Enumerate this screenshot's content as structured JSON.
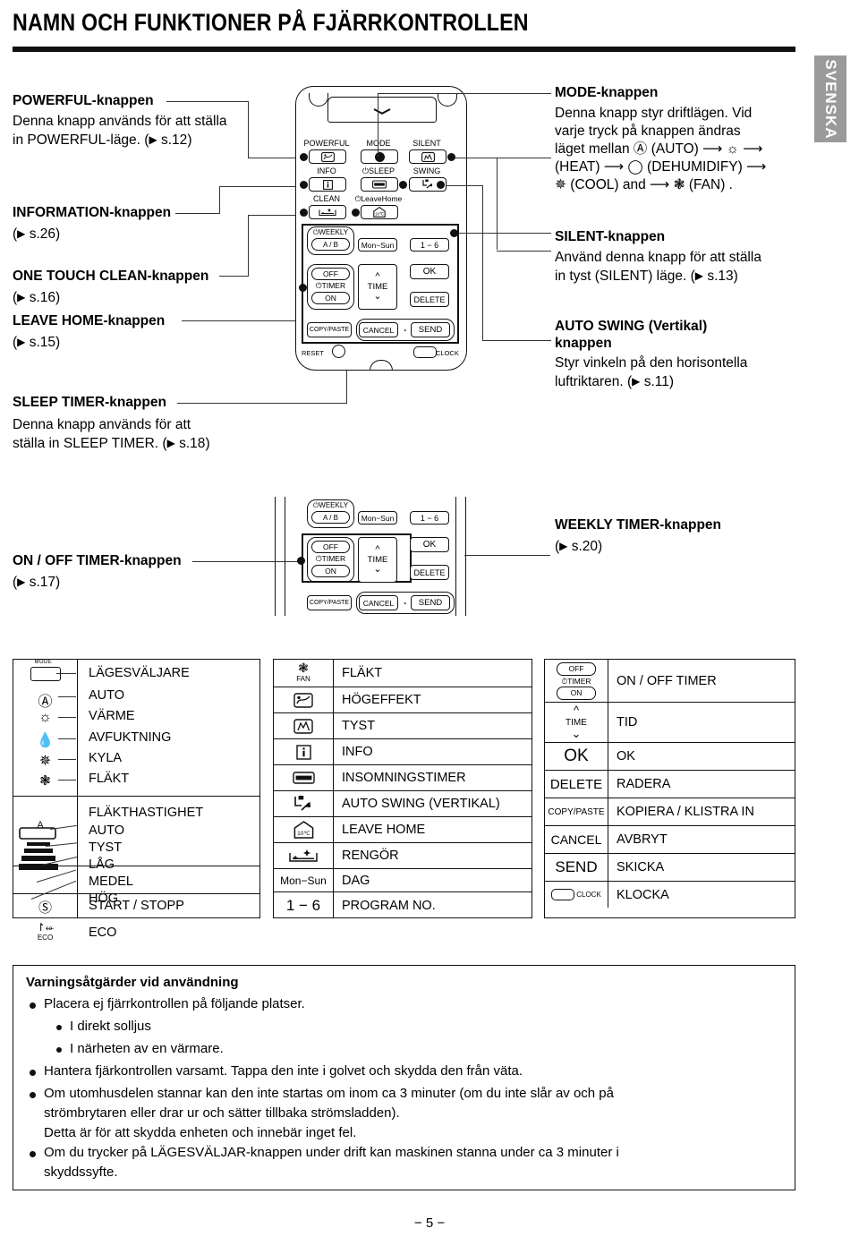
{
  "header": {
    "title": "NAMN OCH FUNKTIONER PÅ FJÄRRKONTROLLEN",
    "language_tab": "SVENSKA"
  },
  "callouts_left": [
    {
      "id": "powerful",
      "heading": "POWERFUL-knappen",
      "body_line1": "Denna knapp används för att ställa",
      "body_line2": "in POWERFUL-läge. (",
      "ref": "s.12",
      "body_line2_end": ")"
    },
    {
      "id": "information",
      "heading": "INFORMATION-knappen",
      "ref_line": "(",
      "ref": "s.26",
      "ref_end": ")"
    },
    {
      "id": "one-touch-clean",
      "heading": "ONE TOUCH CLEAN-knappen",
      "ref_line": "(",
      "ref": "s.16",
      "ref_end": ")"
    },
    {
      "id": "leave-home",
      "heading": "LEAVE HOME-knappen",
      "ref_line": "(",
      "ref": "s.15",
      "ref_end": ")"
    },
    {
      "id": "sleep-timer",
      "heading": "SLEEP TIMER-knappen",
      "body_line1": "Denna knapp används för att",
      "body_line2": "ställa in SLEEP TIMER. (",
      "ref": "s.18",
      "body_line2_end": ")"
    },
    {
      "id": "on-off-timer",
      "heading": "ON / OFF TIMER-knappen",
      "ref_line": "(",
      "ref": "s.17",
      "ref_end": ")"
    }
  ],
  "callouts_right": [
    {
      "id": "mode",
      "heading": "MODE-knappen",
      "l1": "Denna knapp styr driftlägen. Vid",
      "l2": "varje tryck på knappen ändras",
      "l3a": "läget mellan ",
      "l3b": " (AUTO) ",
      "l3c": " ",
      "l4a": "(HEAT) ",
      "l4b": " (DEHUMIDIFY) ",
      "l5a": " (COOL)  and ",
      "l5b": " (FAN) ."
    },
    {
      "id": "silent",
      "heading": "SILENT-knappen",
      "l1": "Använd denna knapp för att ställa",
      "l2a": "in tyst (SILENT) läge. (",
      "ref": "s.13",
      "l2b": ")"
    },
    {
      "id": "auto-swing",
      "heading_l1": "AUTO SWING (Vertikal)",
      "heading_l2": "knappen",
      "l1": "Styr vinkeln på den horisontella",
      "l2a": "luftriktaren. (",
      "ref": "s.11",
      "l2b": ")"
    },
    {
      "id": "weekly-timer",
      "heading": "WEEKLY TIMER-knappen",
      "ref_line": "(",
      "ref": "s.20",
      "ref_end": ")"
    }
  ],
  "remote": {
    "buttons": {
      "powerful": "POWERFUL",
      "mode": "MODE",
      "silent": "SILENT",
      "info": "INFO",
      "sleep": "SLEEP",
      "swing": "SWING",
      "clean": "CLEAN",
      "leave_home": "LeaveHome",
      "weekly": "WEEKLY",
      "ab": "A / B",
      "mon_sun": "Mon−Sun",
      "one_six": "1 − 6",
      "off": "OFF",
      "timer": "TIMER",
      "on": "ON",
      "time": "TIME",
      "ok": "OK",
      "delete": "DELETE",
      "copy_paste": "COPY/PASTE",
      "cancel": "CANCEL",
      "send": "SEND",
      "reset": "RESET",
      "clock": "CLOCK"
    }
  },
  "symbol_table": {
    "left_column": {
      "section1": [
        {
          "icon": "mode-button-icon",
          "label": "LÄGESVÄLJARE"
        },
        {
          "icon": "auto-a-icon",
          "label": "AUTO"
        },
        {
          "icon": "sun-heat-icon",
          "label": "VÄRME"
        },
        {
          "icon": "droplet-dehumidify-icon",
          "label": "AVFUKTNING"
        },
        {
          "icon": "snowflake-cool-icon",
          "label": "KYLA"
        },
        {
          "icon": "fan-icon",
          "label": "FLÄKT"
        }
      ],
      "section2_title": "FLÄKTHASTIGHET",
      "section2": [
        {
          "icon": "fan-speed-auto-icon",
          "label": "AUTO"
        },
        {
          "icon": "fan-speed-silent-icon",
          "label": "TYST"
        },
        {
          "icon": "fan-speed-low-icon",
          "label": "LÅG"
        },
        {
          "icon": "fan-speed-med-icon",
          "label": "MEDEL"
        },
        {
          "icon": "fan-speed-high-icon",
          "label": "HÖG"
        }
      ],
      "section3": [
        {
          "icon": "power-icon",
          "label": "START / STOPP"
        },
        {
          "icon": "eco-icon",
          "label": "ECO"
        }
      ]
    },
    "middle_column": [
      {
        "icon": "fan-icon",
        "icon_label": "FAN",
        "label": "FLÄKT"
      },
      {
        "icon": "powerful-icon",
        "icon_label": "",
        "label": "HÖGEFFEKT"
      },
      {
        "icon": "silent-icon",
        "icon_label": "",
        "label": "TYST"
      },
      {
        "icon": "info-icon",
        "icon_label": "",
        "label": "INFO"
      },
      {
        "icon": "sleep-bed-icon",
        "icon_label": "",
        "label": "INSOMNINGSTIMER"
      },
      {
        "icon": "auto-swing-icon",
        "icon_label": "",
        "label": "AUTO SWING (VERTIKAL)"
      },
      {
        "icon": "leave-home-icon",
        "icon_label": "10°C",
        "label": "LEAVE HOME"
      },
      {
        "icon": "clean-icon",
        "icon_label": "",
        "label": "RENGÖR"
      },
      {
        "icon": "mon-sun-icon",
        "icon_label": "Mon−Sun",
        "label": "DAG"
      },
      {
        "icon": "program-no-icon",
        "icon_label": "1 − 6",
        "label": "PROGRAM NO."
      }
    ],
    "right_column": [
      {
        "icon": "on-off-timer-icon",
        "icon_label": "OFF / TIMER / ON",
        "label": "ON / OFF TIMER"
      },
      {
        "icon": "time-icon",
        "icon_label": "TIME",
        "label": "TID"
      },
      {
        "icon": "ok-icon",
        "icon_label": "OK",
        "label": "OK"
      },
      {
        "icon": "delete-icon",
        "icon_label": "DELETE",
        "label": "RADERA"
      },
      {
        "icon": "copy-paste-icon",
        "icon_label": "COPY/PASTE",
        "label": "KOPIERA / KLISTRA IN"
      },
      {
        "icon": "cancel-icon",
        "icon_label": "CANCEL",
        "label": "AVBRYT"
      },
      {
        "icon": "send-icon",
        "icon_label": "SEND",
        "label": "SKICKA"
      },
      {
        "icon": "clock-icon",
        "icon_label": "CLOCK",
        "label": "KLOCKA"
      }
    ]
  },
  "warnings": {
    "title": "Varningsåtgärder vid användning",
    "items": [
      "Placera ej fjärrkontrollen på följande platser.",
      "I direkt solljus",
      "I närheten av en värmare.",
      "Hantera fjärkontrollen varsamt. Tappa den inte i golvet och skydda den från väta.",
      "Om utomhusdelen stannar kan den inte startas om inom ca 3 minuter (om du inte slår av och på",
      "strömbrytaren eller drar ur och sätter tillbaka strömsladden).",
      "Detta är för att skydda enheten och innebär inget fel.",
      "Om du trycker på LÄGESVÄLJAR-knappen under drift kan maskinen stanna under ca 3 minuter i",
      "skyddssyfte."
    ]
  },
  "page_number": "− 5 −"
}
